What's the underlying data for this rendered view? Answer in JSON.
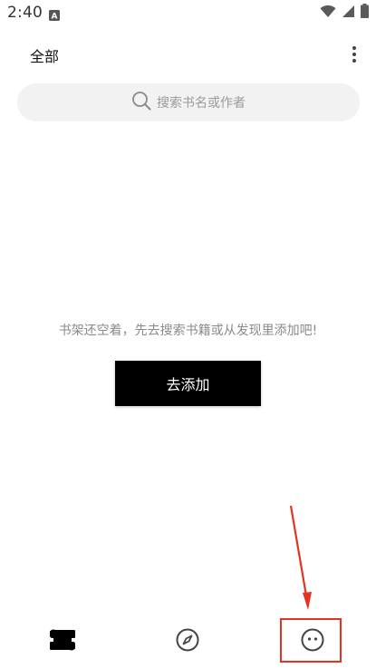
{
  "status_bar": {
    "time": "2:40",
    "notification_icon": "text-a-icon",
    "icons": [
      "wifi-icon",
      "signal-icon",
      "battery-icon"
    ]
  },
  "top_bar": {
    "title": "全部",
    "more_icon": "more-vertical-icon"
  },
  "search": {
    "placeholder": "搜索书名或作者",
    "icon": "search-icon"
  },
  "empty_state": {
    "message": "书架还空着，先去搜索书籍或从发现里添加吧!",
    "button_label": "去添加"
  },
  "bottom_nav": {
    "items": [
      {
        "name": "bookshelf",
        "icon": "bookshelf-icon"
      },
      {
        "name": "discover",
        "icon": "compass-icon"
      },
      {
        "name": "profile",
        "icon": "smiley-face-icon"
      }
    ]
  },
  "annotation": {
    "color": "#e53222"
  }
}
